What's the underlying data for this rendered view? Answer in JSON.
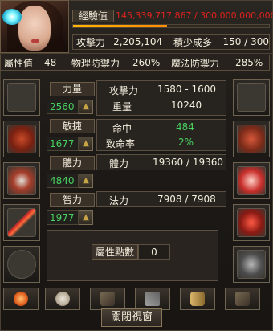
{
  "header": {
    "exp_label": "經驗值",
    "exp_current": "145,339,717,867",
    "exp_sep": " / ",
    "exp_max": "300,000,000,000",
    "exp_progress": 0.48
  },
  "row1": {
    "attack_label": "攻擊力",
    "attack_value": "2,205,104",
    "accum_label": "積少成多",
    "accum_value": "150 / 300"
  },
  "row2": {
    "attr_label": "屬性值",
    "attr_value": "48",
    "phys_def_label": "物理防禦力",
    "phys_def_value": "260%",
    "magic_def_label": "魔法防禦力",
    "magic_def_value": "285%"
  },
  "stats": [
    {
      "name": "力量",
      "value": "2560"
    },
    {
      "name": "敏捷",
      "value": "1677"
    },
    {
      "name": "體力",
      "value": "4840"
    },
    {
      "name": "智力",
      "value": "1977"
    }
  ],
  "mid": {
    "attack_label": "攻擊力",
    "attack_value": "1580 - 1600",
    "weight_label": "重量",
    "weight_value": "10240",
    "hit_label": "命中",
    "hit_value": "484",
    "crit_label": "致命率",
    "crit_value": "2%",
    "hp_label": "體力",
    "hp_value": "19360 / 19360",
    "mp_label": "法力",
    "mp_value": "7908 / 7908"
  },
  "attr_points": {
    "label": "屬性點數",
    "value": "0"
  },
  "close_label": "關閉視窗",
  "colors": {
    "accent": "#ff9a00",
    "green": "#48d160",
    "exp_red": "#e0221e"
  }
}
